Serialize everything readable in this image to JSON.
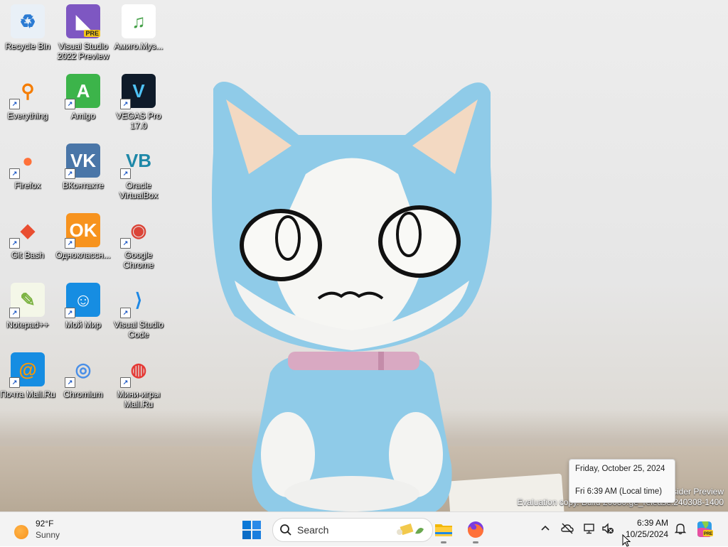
{
  "desktop_icons": [
    {
      "name": "recycle-bin-icon",
      "label": "Recycle Bin",
      "bg": "#e9f0f7",
      "fg": "#2b7bd3",
      "glyph": "♻",
      "shortcut": false
    },
    {
      "name": "visual-studio-2022-preview-icon",
      "label": "Visual Studio 2022 Preview",
      "bg": "#7e57c2",
      "fg": "#ffffff",
      "glyph": "◣",
      "badge": "PRE",
      "shortcut": false
    },
    {
      "name": "amigo-music-icon",
      "label": "Амиго.Муз...",
      "bg": "#ffffff",
      "fg": "#43a047",
      "glyph": "♫",
      "shortcut": false
    },
    {
      "name": "everything-icon",
      "label": "Everything",
      "bg": "transparent",
      "fg": "#f57c00",
      "glyph": "⚲",
      "shortcut": true
    },
    {
      "name": "amigo-icon",
      "label": "Amigo",
      "bg": "#3cb44a",
      "fg": "#ffffff",
      "glyph": "A",
      "shortcut": true
    },
    {
      "name": "vegas-pro-icon",
      "label": "VEGAS Pro 17.0",
      "bg": "#0f1b2a",
      "fg": "#4fc3f7",
      "glyph": "V",
      "shortcut": true
    },
    {
      "name": "firefox-icon",
      "label": "Firefox",
      "bg": "transparent",
      "fg": "#ff7139",
      "glyph": "●",
      "shortcut": true
    },
    {
      "name": "vkontakte-icon",
      "label": "ВКонтакте",
      "bg": "#4a76a8",
      "fg": "#ffffff",
      "glyph": "VK",
      "shortcut": true
    },
    {
      "name": "oracle-virtualbox-icon",
      "label": "Oracle VirtualBox",
      "bg": "transparent",
      "fg": "#1e88a8",
      "glyph": "VB",
      "shortcut": true
    },
    {
      "name": "git-bash-icon",
      "label": "Git Bash",
      "bg": "transparent",
      "fg": "#e94e31",
      "glyph": "◆",
      "shortcut": true
    },
    {
      "name": "odnoklassniki-icon",
      "label": "Одноклассн...",
      "bg": "#f7931e",
      "fg": "#ffffff",
      "glyph": "OK",
      "shortcut": true
    },
    {
      "name": "google-chrome-icon",
      "label": "Google Chrome",
      "bg": "transparent",
      "fg": "#db4437",
      "glyph": "◉",
      "shortcut": true
    },
    {
      "name": "notepad-plus-plus-icon",
      "label": "Notepad++",
      "bg": "#f4f7e8",
      "fg": "#7cb342",
      "glyph": "✎",
      "shortcut": true
    },
    {
      "name": "moy-mir-icon",
      "label": "Мой Мир",
      "bg": "#168de2",
      "fg": "#ffffff",
      "glyph": "☺",
      "shortcut": true
    },
    {
      "name": "vscode-icon",
      "label": "Visual Studio Code",
      "bg": "transparent",
      "fg": "#1e88e5",
      "glyph": "⟩",
      "shortcut": true
    },
    {
      "name": "mail-ru-icon",
      "label": "Почта Mail.Ru",
      "bg": "#168de2",
      "fg": "#ff9800",
      "glyph": "@",
      "shortcut": true
    },
    {
      "name": "chromium-icon",
      "label": "Chromium",
      "bg": "transparent",
      "fg": "#4a8fe7",
      "glyph": "◎",
      "shortcut": true
    },
    {
      "name": "mini-games-mail-ru-icon",
      "label": "Мини-игры Mail.Ru",
      "bg": "transparent",
      "fg": "#e53935",
      "glyph": "◍",
      "shortcut": true
    }
  ],
  "watermark": {
    "line1": "Windows 11 Pro Insider Preview",
    "line2": "Evaluation copy. Build 26080.ge_release.240308-1400"
  },
  "tooltip": {
    "line1": "Friday, October 25, 2024",
    "line2": "Fri 6:39 AM (Local time)"
  },
  "taskbar": {
    "weather": {
      "temp": "92°F",
      "condition": "Sunny"
    },
    "search": {
      "label": "Search"
    },
    "pinned": [
      "file-explorer-icon",
      "firefox-taskbar-icon"
    ],
    "clock": {
      "time": "6:39 AM",
      "date": "10/25/2024"
    }
  },
  "colors": {
    "taskbar": "#f3f3f3",
    "accent": "#0078d4"
  }
}
